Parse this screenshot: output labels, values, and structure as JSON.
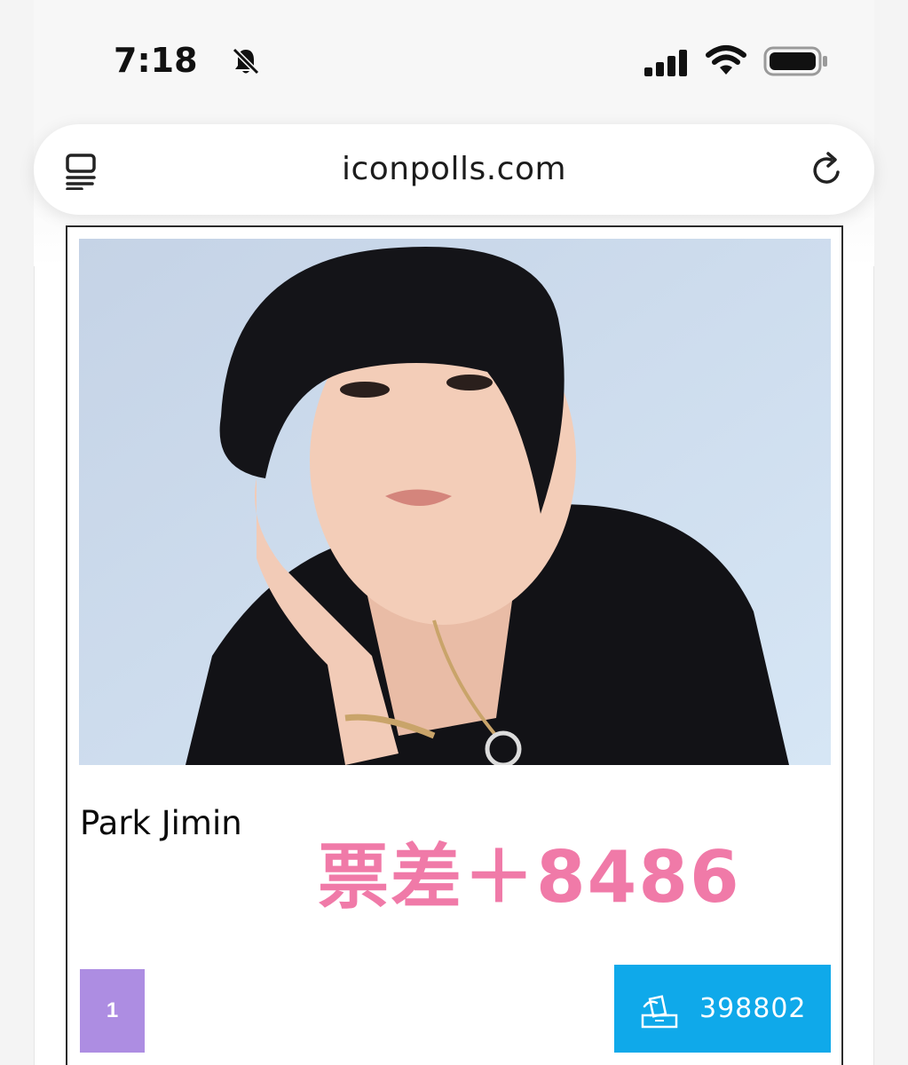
{
  "status_bar": {
    "time": "7:18",
    "icons": [
      "bell-slash-icon",
      "cellular-signal-icon",
      "wifi-icon",
      "battery-icon"
    ]
  },
  "browser": {
    "url": "iconpolls.com",
    "icons": [
      "tabs-icon",
      "reload-icon"
    ]
  },
  "candidate": {
    "name": "Park Jimin",
    "rank": "1",
    "votes": "398802",
    "overlay_text": "票差＋8486",
    "vote_icon": "ballot-box-icon"
  },
  "colors": {
    "rank_badge": "#ad8de2",
    "vote_button": "#0fa9ea",
    "overlay_text": "#f07aa8"
  }
}
